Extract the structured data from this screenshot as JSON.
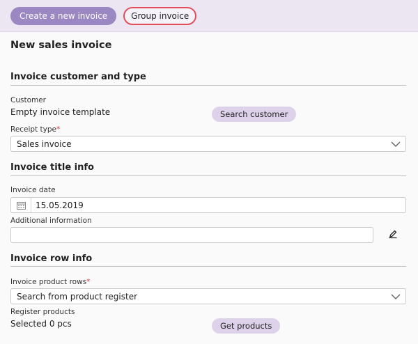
{
  "toolbar": {
    "create_label": "Create a new invoice",
    "group_label": "Group invoice"
  },
  "page_title": "New sales invoice",
  "customer_section": {
    "title": "Invoice customer and type",
    "customer_label": "Customer",
    "customer_value": "Empty invoice template",
    "search_customer_label": "Search customer",
    "receipt_type_label": "Receipt type",
    "receipt_type_required": "*",
    "receipt_type_value": "Sales invoice"
  },
  "title_section": {
    "title": "Invoice title info",
    "date_label": "Invoice date",
    "date_value": "15.05.2019",
    "additional_label": "Additional information",
    "additional_value": ""
  },
  "row_section": {
    "title": "Invoice row info",
    "product_rows_label": "Invoice product rows",
    "product_rows_required": "*",
    "product_rows_value": "Search from product register",
    "register_label": "Register products",
    "selected_value": "Selected 0 pcs",
    "get_products_label": "Get products"
  },
  "colors": {
    "accent": "#9b87c2",
    "soft_button": "#ddd2ea",
    "highlight_border": "#e0505b",
    "topbar": "#ece6f3"
  },
  "icons": [
    "calendar-icon",
    "chevron-down-icon",
    "pencil-icon"
  ]
}
